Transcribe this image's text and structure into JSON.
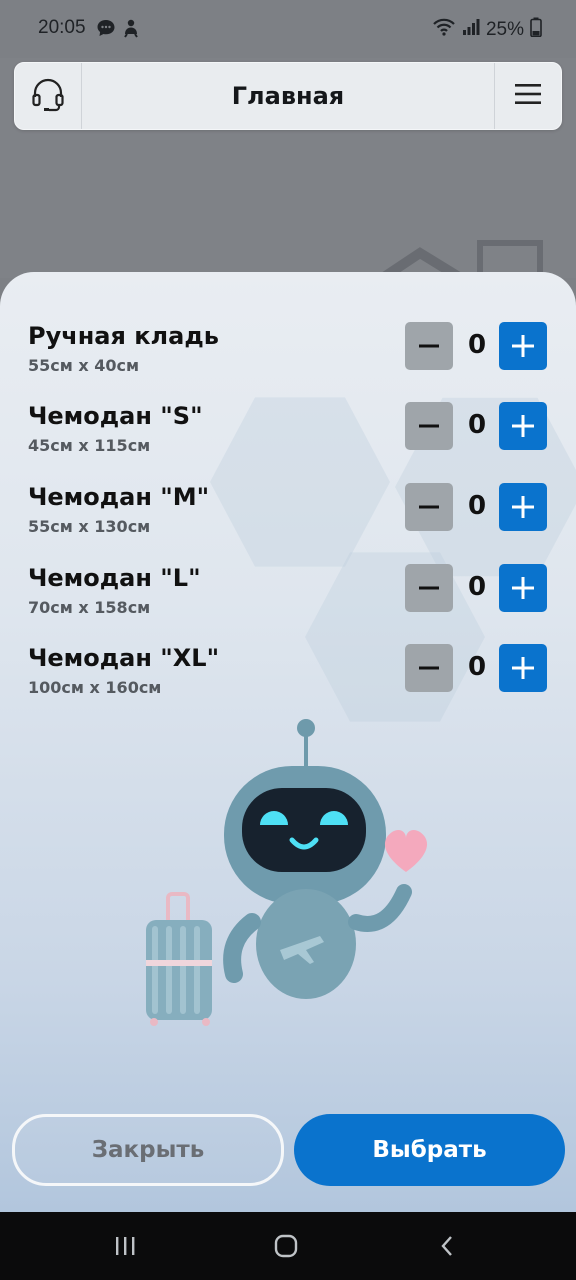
{
  "status_bar": {
    "time": "20:05",
    "battery": "25%",
    "icons": [
      "message-icon",
      "notification-icon",
      "wifi-icon",
      "signal-icon",
      "battery-icon"
    ]
  },
  "header": {
    "title": "Главная",
    "left_icon": "headset-icon",
    "right_icon": "menu-icon"
  },
  "luggage": {
    "items": [
      {
        "name": "Ручная кладь",
        "size": "55см x 40см",
        "count": "0"
      },
      {
        "name": "Чемодан \"S\"",
        "size": "45см x 115см",
        "count": "0"
      },
      {
        "name": "Чемодан \"M\"",
        "size": "55см x 130см",
        "count": "0"
      },
      {
        "name": "Чемодан \"L\"",
        "size": "70см x 158см",
        "count": "0"
      },
      {
        "name": "Чемодан \"XL\"",
        "size": "100см x 160см",
        "count": "0"
      }
    ]
  },
  "actions": {
    "close_label": "Закрыть",
    "select_label": "Выбрать"
  },
  "colors": {
    "accent": "#0a73cd",
    "minus_button": "#9fa5aa",
    "nav_bar": "#0b0b0c"
  },
  "navbar": {
    "icons": [
      "recent-apps-icon",
      "home-icon",
      "back-icon"
    ]
  }
}
